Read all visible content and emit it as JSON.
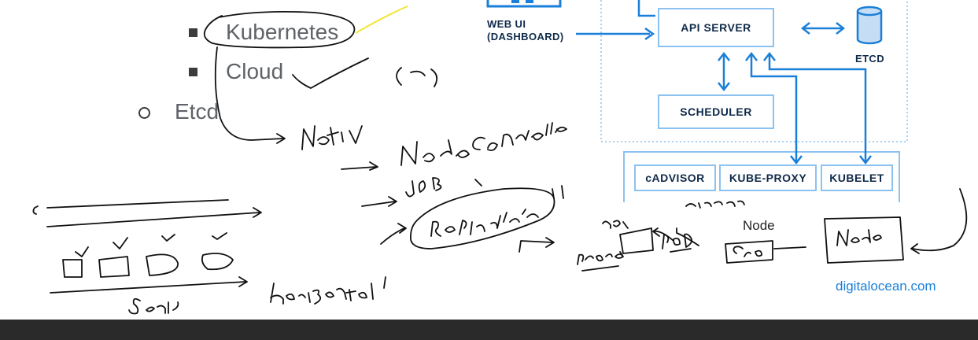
{
  "bullets": {
    "kubernetes": "Kubernetes",
    "cloud": "Cloud",
    "etcd": "Etcd"
  },
  "diagram": {
    "web_ui_line1": "WEB UI",
    "web_ui_line2": "(DASHBOARD)",
    "api_server": "API SERVER",
    "etcd": "ETCD",
    "scheduler": "SCHEDULER",
    "cadvisor": "cADVISOR",
    "kube_proxy": "KUBE-PROXY",
    "kubelet": "KUBELET",
    "node": "Node"
  },
  "brand": "digitalocean.com",
  "colors": {
    "box_border": "#8cc2f0",
    "arrow": "#1a7fd8",
    "box_text": "#0f2a4a",
    "ink": "#111111",
    "highlight": "#f2e63a",
    "bar": "#2a2a2a"
  }
}
